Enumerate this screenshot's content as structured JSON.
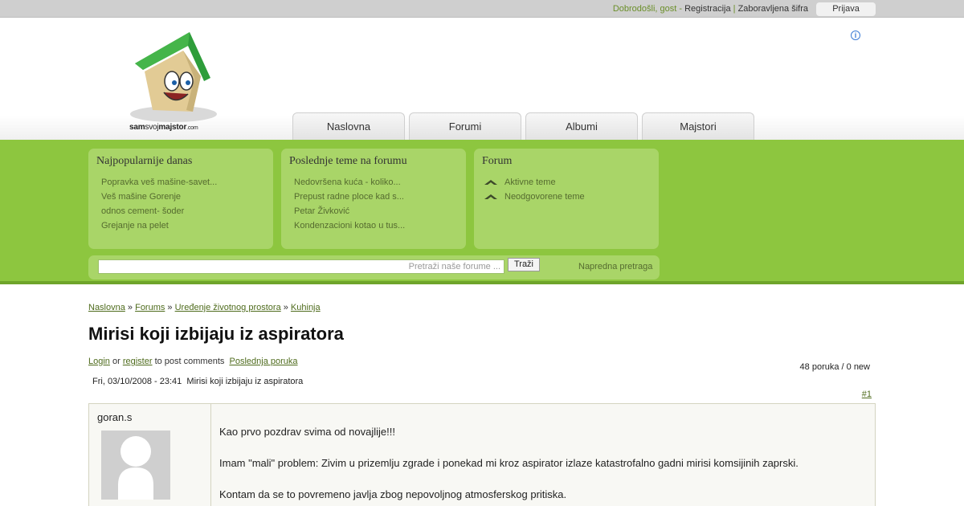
{
  "topbar": {
    "welcome": "Dobrodošli, gost",
    "dash": " - ",
    "register": "Registracija",
    "pipe": " | ",
    "forgot": "Zaboravljena šifra",
    "login": "Prijava"
  },
  "logo": {
    "sam": "sam",
    "svoj": "svoj",
    "majstor": "majstor",
    "dotcom": ".com"
  },
  "info_icon": "ⓘ",
  "nav": [
    "Naslovna",
    "Forumi",
    "Albumi",
    "Majstori"
  ],
  "boxes": {
    "popular": {
      "title": "Najpopularnije danas",
      "items": [
        "Popravka veš mašine-savet...",
        "Veš mašine Gorenje",
        "odnos cement- šoder",
        "Grejanje na pelet"
      ]
    },
    "latest": {
      "title": "Poslednje teme na forumu",
      "items": [
        "Nedovršena kuća - koliko...",
        "Prepust radne ploce kad s...",
        "Petar Živković",
        "Kondenzacioni kotao u tus..."
      ]
    },
    "forum": {
      "title": "Forum",
      "items": [
        "Aktivne teme",
        "Neodgovorene teme"
      ]
    }
  },
  "search": {
    "placeholder": "Pretraži naše forume ...",
    "button": "Traži",
    "advanced": "Napredna pretraga"
  },
  "breadcrumb": {
    "items": [
      "Naslovna",
      "Forums",
      "Uređenje životnog prostora",
      "Kuhinja"
    ],
    "sep": " » "
  },
  "title": "Mirisi koji izbijaju iz aspiratora",
  "postlinks": {
    "login": "Login",
    "or": " or ",
    "register": "register",
    "to_post": " to post comments",
    "last": "Poslednja poruka"
  },
  "count": "48 poruka / 0 new",
  "post": {
    "date": "Fri, 03/10/2008 - 23:41",
    "subject": "Mirisi koji izbijaju iz aspiratora",
    "number": "#1",
    "author": "goran.s",
    "paragraphs": [
      "Kao prvo pozdrav svima od novajlije!!!",
      "Imam \"mali\" problem: Zivim u prizemlju zgrade i ponekad mi kroz aspirator izlaze katastrofalno gadni mirisi komsijinih zaprski.",
      "Kontam da se to povremeno javlja zbog nepovoljnog atmosferskog pritiska."
    ]
  },
  "colors": {
    "green": "#8dc63f",
    "box": "#a9d568",
    "link": "#4e6b1c"
  }
}
